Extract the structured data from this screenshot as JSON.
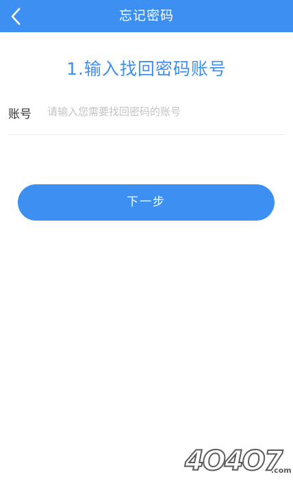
{
  "header": {
    "title": "忘记密码",
    "back_icon": "chevron-left-icon"
  },
  "step": {
    "title": "1.输入找回密码账号"
  },
  "account_field": {
    "label": "账号",
    "value": "",
    "placeholder": "请输入您需要找回密码的账号"
  },
  "next_button": {
    "label": "下一步"
  },
  "watermark": {
    "text": "4O4O7",
    "suffix": ".com"
  },
  "colors": {
    "accent": "#3d8ff2",
    "background": "#ffffff",
    "placeholder": "#c3c3c3",
    "divider": "#ececec"
  }
}
